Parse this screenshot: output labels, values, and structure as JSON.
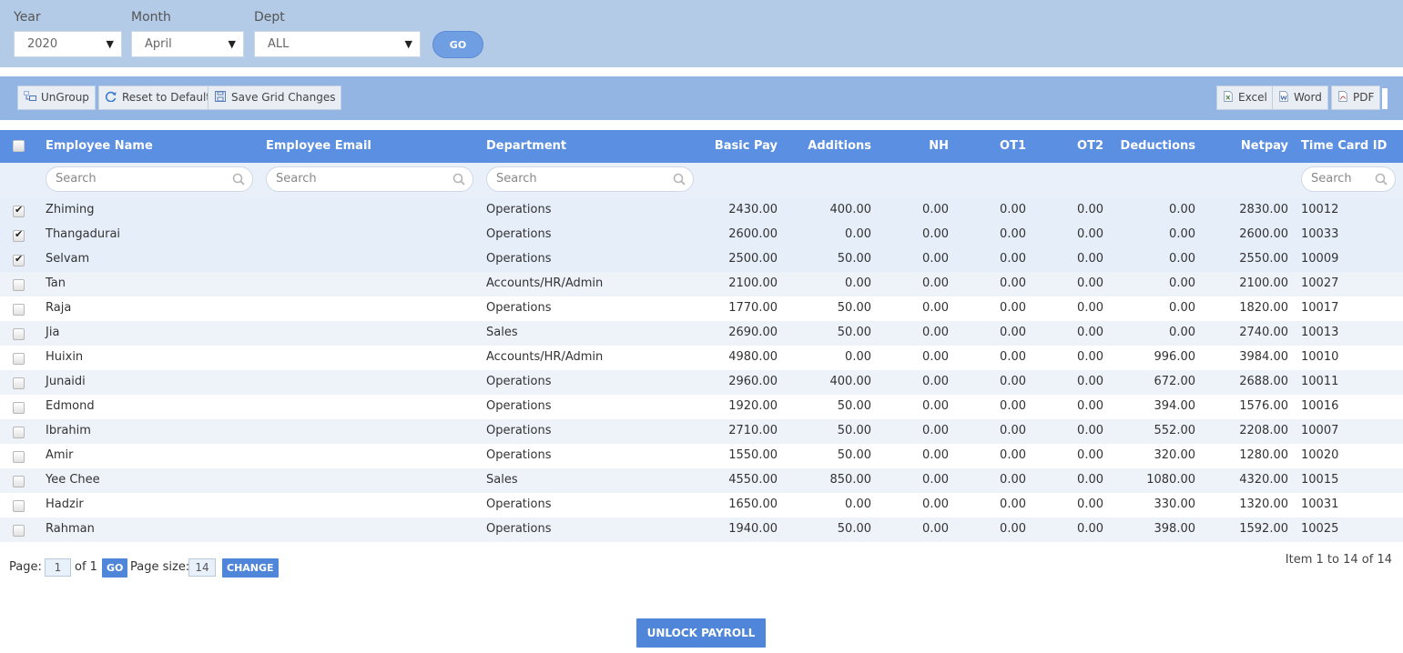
{
  "filters": {
    "year_label": "Year",
    "year_value": "2020",
    "month_label": "Month",
    "month_value": "April",
    "dept_label": "Dept",
    "dept_value": "ALL",
    "go_label": "GO"
  },
  "toolbar": {
    "ungroup": "UnGroup",
    "reset": "Reset to Default",
    "save": "Save Grid Changes",
    "excel": "Excel",
    "word": "Word",
    "pdf": "PDF"
  },
  "grid": {
    "columns": {
      "name": "Employee Name",
      "email": "Employee Email",
      "department": "Department",
      "basic": "Basic Pay",
      "additions": "Additions",
      "nh": "NH",
      "ot1": "OT1",
      "ot2": "OT2",
      "deductions": "Deductions",
      "netpay": "Netpay",
      "timecard": "Time Card ID"
    },
    "search_placeholder": "Search",
    "rows": [
      {
        "checked": true,
        "name": "Zhiming",
        "email": "",
        "department": "Operations",
        "basic": "2430.00",
        "additions": "400.00",
        "nh": "0.00",
        "ot1": "0.00",
        "ot2": "0.00",
        "deductions": "0.00",
        "netpay": "2830.00",
        "timecard": "10012"
      },
      {
        "checked": true,
        "name": "Thangadurai",
        "email": "",
        "department": "Operations",
        "basic": "2600.00",
        "additions": "0.00",
        "nh": "0.00",
        "ot1": "0.00",
        "ot2": "0.00",
        "deductions": "0.00",
        "netpay": "2600.00",
        "timecard": "10033"
      },
      {
        "checked": true,
        "name": "Selvam",
        "email": "",
        "department": "Operations",
        "basic": "2500.00",
        "additions": "50.00",
        "nh": "0.00",
        "ot1": "0.00",
        "ot2": "0.00",
        "deductions": "0.00",
        "netpay": "2550.00",
        "timecard": "10009"
      },
      {
        "checked": false,
        "name": "Tan",
        "email": "",
        "department": "Accounts/HR/Admin",
        "basic": "2100.00",
        "additions": "0.00",
        "nh": "0.00",
        "ot1": "0.00",
        "ot2": "0.00",
        "deductions": "0.00",
        "netpay": "2100.00",
        "timecard": "10027"
      },
      {
        "checked": false,
        "name": "Raja",
        "email": "",
        "department": "Operations",
        "basic": "1770.00",
        "additions": "50.00",
        "nh": "0.00",
        "ot1": "0.00",
        "ot2": "0.00",
        "deductions": "0.00",
        "netpay": "1820.00",
        "timecard": "10017"
      },
      {
        "checked": false,
        "name": "Jia",
        "email": "",
        "department": "Sales",
        "basic": "2690.00",
        "additions": "50.00",
        "nh": "0.00",
        "ot1": "0.00",
        "ot2": "0.00",
        "deductions": "0.00",
        "netpay": "2740.00",
        "timecard": "10013"
      },
      {
        "checked": false,
        "name": "Huixin",
        "email": "",
        "department": "Accounts/HR/Admin",
        "basic": "4980.00",
        "additions": "0.00",
        "nh": "0.00",
        "ot1": "0.00",
        "ot2": "0.00",
        "deductions": "996.00",
        "netpay": "3984.00",
        "timecard": "10010"
      },
      {
        "checked": false,
        "name": "Junaidi",
        "email": "",
        "department": "Operations",
        "basic": "2960.00",
        "additions": "400.00",
        "nh": "0.00",
        "ot1": "0.00",
        "ot2": "0.00",
        "deductions": "672.00",
        "netpay": "2688.00",
        "timecard": "10011"
      },
      {
        "checked": false,
        "name": "Edmond",
        "email": "",
        "department": "Operations",
        "basic": "1920.00",
        "additions": "50.00",
        "nh": "0.00",
        "ot1": "0.00",
        "ot2": "0.00",
        "deductions": "394.00",
        "netpay": "1576.00",
        "timecard": "10016"
      },
      {
        "checked": false,
        "name": "Ibrahim",
        "email": "",
        "department": "Operations",
        "basic": "2710.00",
        "additions": "50.00",
        "nh": "0.00",
        "ot1": "0.00",
        "ot2": "0.00",
        "deductions": "552.00",
        "netpay": "2208.00",
        "timecard": "10007"
      },
      {
        "checked": false,
        "name": "Amir",
        "email": "",
        "department": "Operations",
        "basic": "1550.00",
        "additions": "50.00",
        "nh": "0.00",
        "ot1": "0.00",
        "ot2": "0.00",
        "deductions": "320.00",
        "netpay": "1280.00",
        "timecard": "10020"
      },
      {
        "checked": false,
        "name": "Yee Chee",
        "email": "",
        "department": "Sales",
        "basic": "4550.00",
        "additions": "850.00",
        "nh": "0.00",
        "ot1": "0.00",
        "ot2": "0.00",
        "deductions": "1080.00",
        "netpay": "4320.00",
        "timecard": "10015"
      },
      {
        "checked": false,
        "name": "Hadzir",
        "email": "",
        "department": "Operations",
        "basic": "1650.00",
        "additions": "0.00",
        "nh": "0.00",
        "ot1": "0.00",
        "ot2": "0.00",
        "deductions": "330.00",
        "netpay": "1320.00",
        "timecard": "10031"
      },
      {
        "checked": false,
        "name": "Rahman",
        "email": "",
        "department": "Operations",
        "basic": "1940.00",
        "additions": "50.00",
        "nh": "0.00",
        "ot1": "0.00",
        "ot2": "0.00",
        "deductions": "398.00",
        "netpay": "1592.00",
        "timecard": "10025"
      }
    ]
  },
  "pager": {
    "page_label": "Page:",
    "page_value": "1",
    "of_label": "of 1",
    "go_label": "GO",
    "size_label": "Page size:",
    "size_value": "14",
    "change_label": "CHANGE",
    "items_info": "Item 1 to 14 of 14"
  },
  "unlock_label": "UNLOCK PAYROLL",
  "colors": {
    "filter_bar": "#b4cbe7",
    "toolbar": "#92b5e3",
    "header": "#5a8fe2",
    "primary_button": "#4f86d9"
  }
}
